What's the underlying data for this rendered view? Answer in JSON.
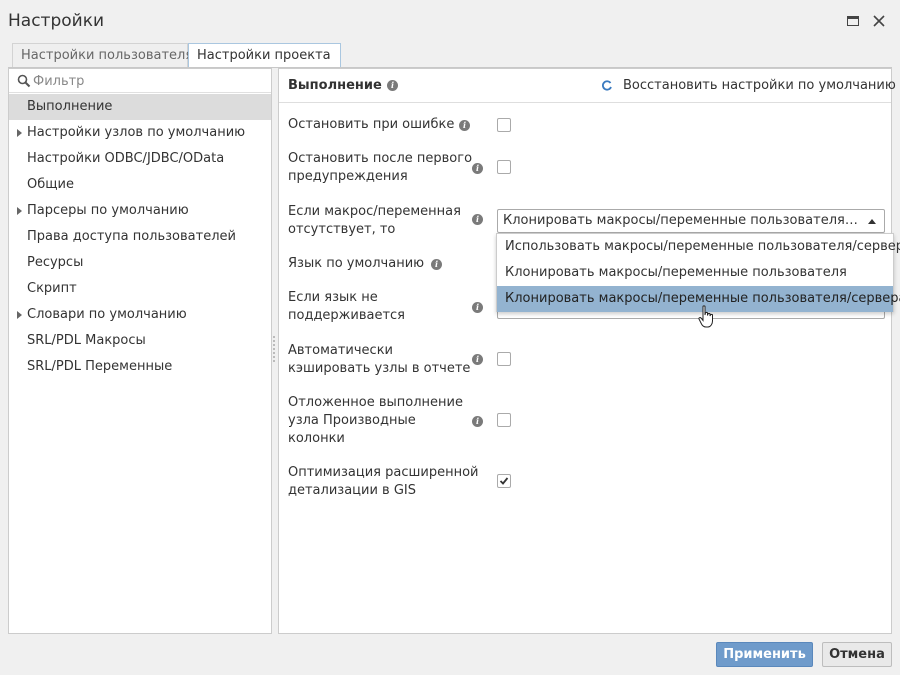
{
  "window": {
    "title": "Настройки"
  },
  "tabs": [
    {
      "label": "Настройки пользователя"
    },
    {
      "label": "Настройки проекта"
    }
  ],
  "filter": {
    "placeholder": "Фильтр",
    "value": ""
  },
  "tree": [
    {
      "label": "Выполнение"
    },
    {
      "label": "Настройки узлов по умолчанию"
    },
    {
      "label": "Настройки ODBC/JDBC/OData"
    },
    {
      "label": "Общие"
    },
    {
      "label": "Парсеры по умолчанию"
    },
    {
      "label": "Права доступа пользователей"
    },
    {
      "label": "Ресурсы"
    },
    {
      "label": "Скрипт"
    },
    {
      "label": "Словари по умолчанию"
    },
    {
      "label": "SRL/PDL Макросы"
    },
    {
      "label": "SRL/PDL Переменные"
    }
  ],
  "section": {
    "title": "Выполнение",
    "restore_label": "Восстановить настройки по умолчанию"
  },
  "settings": {
    "stop_on_error": {
      "label": "Остановить при ошибке"
    },
    "stop_on_warning": {
      "label_line1": "Остановить после первого",
      "label_line2": "предупреждения"
    },
    "missing_macro": {
      "label_line1": "Если макрос/переменная",
      "label_line2": "отсутствует, то",
      "value": "Клонировать макросы/переменные пользователя/сервера"
    },
    "default_language": {
      "label": "Язык по умолчанию"
    },
    "unsupported_language": {
      "label_line1": "Если язык не",
      "label_line2": "поддерживается"
    },
    "auto_cache": {
      "label_line1": "Автоматически",
      "label_line2": "кэшировать узлы в отчете"
    },
    "deferred_exec": {
      "label_line1": "Отложенное выполнение",
      "label_line2": "узла Производные",
      "label_line3": "колонки"
    },
    "gis_optimization": {
      "label_line1": "Оптимизация расширенной",
      "label_line2": "детализации в GIS"
    }
  },
  "dropdown": {
    "options": [
      "Использовать макросы/переменные пользователя/сервера",
      "Клонировать макросы/переменные пользователя",
      "Клонировать макросы/переменные пользователя/сервера"
    ]
  },
  "footer": {
    "apply_label": "Применить",
    "cancel_label": "Отмена"
  },
  "colors": {
    "accent": "#6f9bcb",
    "highlight": "#93b3d0",
    "selected_tree": "#dcdcdc"
  }
}
